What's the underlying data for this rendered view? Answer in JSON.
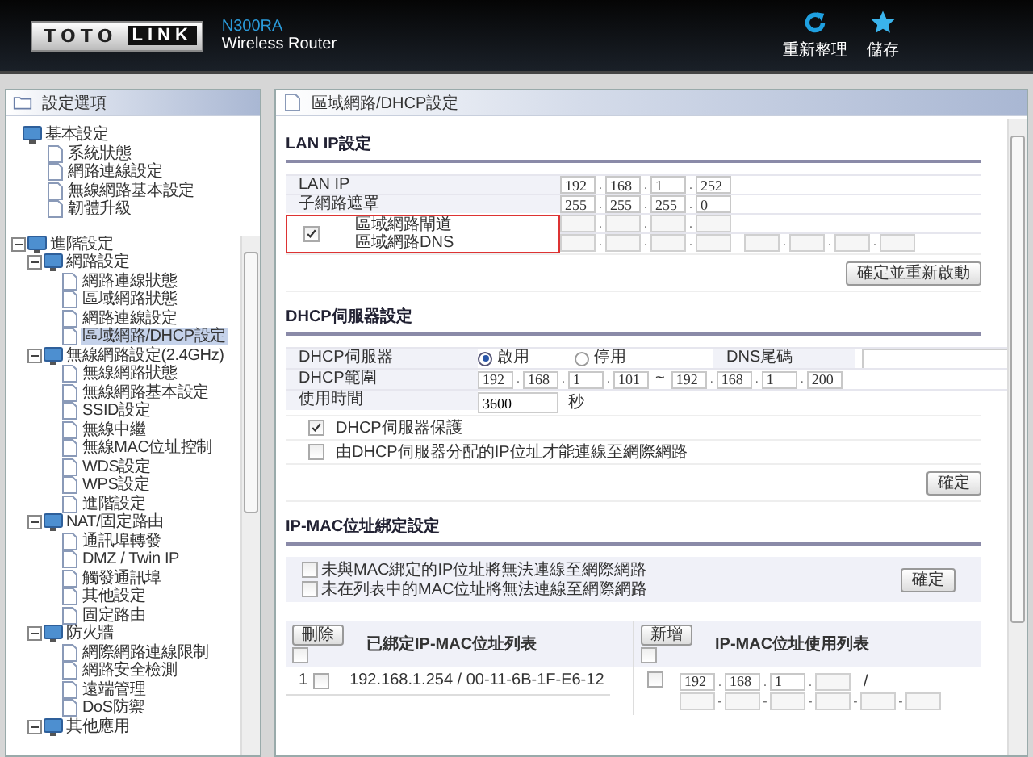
{
  "header": {
    "logo_left": "TOTO",
    "logo_right": "LINK",
    "model": "N300RA",
    "subtitle": "Wireless Router",
    "actions": [
      {
        "kind": "refresh",
        "label": "重新整理"
      },
      {
        "kind": "save",
        "label": "儲存"
      }
    ]
  },
  "sidebar": {
    "title": "設定選項",
    "tree": [
      {
        "label": "基本設定",
        "selected": false,
        "children": [
          {
            "label": "系統狀態",
            "selected": false
          },
          {
            "label": "網路連線設定",
            "selected": false
          },
          {
            "label": "無線網路基本設定",
            "selected": false
          },
          {
            "label": "韌體升級",
            "selected": false
          }
        ]
      },
      {
        "label": "進階設定",
        "selected": false,
        "expanded": true,
        "children": [
          {
            "label": "網路設定",
            "selected": false,
            "expanded": true,
            "children": [
              {
                "label": "網路連線狀態",
                "selected": false
              },
              {
                "label": "區域網路狀態",
                "selected": false
              },
              {
                "label": "網路連線設定",
                "selected": false
              },
              {
                "label": "區域網路/DHCP設定",
                "selected": true
              }
            ]
          },
          {
            "label": "無線網路設定(2.4GHz)",
            "selected": false,
            "expanded": true,
            "children": [
              {
                "label": "無線網路狀態",
                "selected": false
              },
              {
                "label": "無線網路基本設定",
                "selected": false
              },
              {
                "label": "SSID設定",
                "selected": false
              },
              {
                "label": "無線中繼",
                "selected": false
              },
              {
                "label": "無線MAC位址控制",
                "selected": false
              },
              {
                "label": "WDS設定",
                "selected": false
              },
              {
                "label": "WPS設定",
                "selected": false
              },
              {
                "label": "進階設定",
                "selected": false
              }
            ]
          },
          {
            "label": "NAT/固定路由",
            "selected": false,
            "expanded": true,
            "children": [
              {
                "label": "通訊埠轉發",
                "selected": false
              },
              {
                "label": "DMZ / Twin IP",
                "selected": false
              },
              {
                "label": "觸發通訊埠",
                "selected": false
              },
              {
                "label": "其他設定",
                "selected": false
              },
              {
                "label": "固定路由",
                "selected": false
              }
            ]
          },
          {
            "label": "防火牆",
            "selected": false,
            "expanded": true,
            "children": [
              {
                "label": "網際網路連線限制",
                "selected": false
              },
              {
                "label": "網路安全檢測",
                "selected": false
              },
              {
                "label": "遠端管理",
                "selected": false
              },
              {
                "label": "DoS防禦",
                "selected": false
              }
            ]
          },
          {
            "label": "其他應用",
            "selected": false,
            "expanded": true
          }
        ]
      }
    ]
  },
  "main": {
    "title": "區域網路/DHCP設定",
    "octet_separator": ".",
    "mac_separator": "-",
    "lan": {
      "heading": "LAN IP設定",
      "rows": [
        {
          "label": "LAN IP",
          "fields": [
            "192",
            "168",
            "1",
            "252"
          ]
        },
        {
          "label": "子網路遮罩",
          "fields": [
            "255",
            "255",
            "255",
            "0"
          ]
        }
      ],
      "manual": {
        "checked": true,
        "labels": [
          "區域網路閘道",
          "區域網路DNS"
        ],
        "gateway": [
          {
            "kind": "empty"
          },
          {
            "kind": "empty"
          },
          {
            "kind": "empty"
          },
          {
            "kind": "empty"
          }
        ],
        "dns": [
          [
            {
              "kind": "empty"
            },
            {
              "kind": "empty"
            },
            {
              "kind": "empty"
            },
            {
              "kind": "empty"
            }
          ],
          [
            {
              "kind": "empty"
            },
            {
              "kind": "empty"
            },
            {
              "kind": "empty"
            },
            {
              "kind": "empty"
            }
          ]
        ]
      },
      "button": "確定並重新啟動"
    },
    "dhcp": {
      "heading": "DHCP伺服器設定",
      "server_label": "DHCP伺服器",
      "options": [
        {
          "label": "啟用",
          "selected": true
        },
        {
          "label": "停用",
          "selected": false
        }
      ],
      "dns_suffix_label": "DNS尾碼",
      "range_label": "DHCP範圍",
      "range_start": [
        "192",
        "168",
        "1",
        "101"
      ],
      "range_sep": "~",
      "range_end": [
        "192",
        "168",
        "1",
        "200"
      ],
      "lease_label": "使用時間",
      "lease_value": "3600",
      "lease_unit": "秒",
      "checks": [
        {
          "label": "DHCP伺服器保護",
          "checked": true
        },
        {
          "label": "由DHCP伺服器分配的IP位址才能連線至網際網路",
          "checked": false
        }
      ],
      "button": "確定"
    },
    "binding": {
      "heading": "IP-MAC位址綁定設定",
      "checks": [
        {
          "label": "未與MAC綁定的IP位址將無法連線至網際網路",
          "checked": false
        },
        {
          "label": "未在列表中的MAC位址將無法連線至網際網路",
          "checked": false
        }
      ],
      "button": "確定",
      "bound": {
        "button": "刪除",
        "title": "已綁定IP-MAC位址列表",
        "select_all": false,
        "rows": [
          {
            "index": "1",
            "checked": false,
            "entry": "192.168.1.254 / 00-11-6B-1F-E6-12"
          }
        ]
      },
      "available": {
        "button": "新增",
        "title": "IP-MAC位址使用列表",
        "select_all": false,
        "rows": [
          {
            "checked": false,
            "ip": [
              {
                "kind": "filled",
                "value": "192"
              },
              {
                "kind": "filled",
                "value": "168"
              },
              {
                "kind": "filled",
                "value": "1"
              },
              {
                "kind": "empty"
              }
            ],
            "ip_sep": "/",
            "mac": [
              {
                "kind": "empty"
              },
              {
                "kind": "empty"
              },
              {
                "kind": "empty"
              },
              {
                "kind": "empty"
              },
              {
                "kind": "empty"
              },
              {
                "kind": "empty"
              }
            ]
          }
        ]
      }
    }
  }
}
